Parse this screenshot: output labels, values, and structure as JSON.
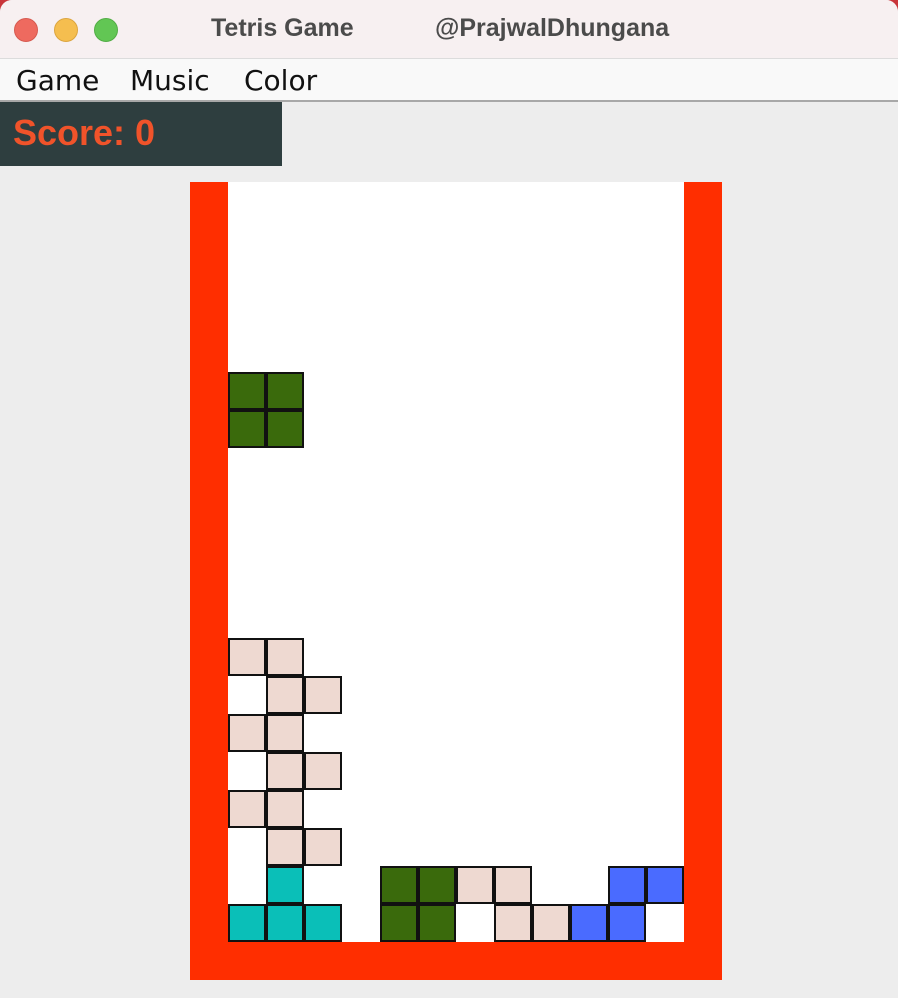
{
  "window": {
    "title": "Tetris Game",
    "author": "@PrajwalDhungana"
  },
  "menu": [
    "Game",
    "Music",
    "Color"
  ],
  "score": {
    "label": "Score: 0",
    "value": 0
  },
  "colors": {
    "frame": "#ff2e00",
    "board": "#ffffff",
    "score_panel": "#2e3e3f",
    "score_text": "#f0532a",
    "green": "#3a6a0c",
    "pink": "#eed9d1",
    "teal": "#0abfb8",
    "blue": "#4a6bff"
  },
  "board": {
    "columns": 12,
    "rows": 20,
    "active_piece": {
      "type": "O",
      "color": "green",
      "cells": [
        [
          0,
          5
        ],
        [
          1,
          5
        ],
        [
          0,
          6
        ],
        [
          1,
          6
        ]
      ]
    },
    "locked_cells": [
      {
        "col": 0,
        "row": 12,
        "color": "pink"
      },
      {
        "col": 1,
        "row": 12,
        "color": "pink"
      },
      {
        "col": 1,
        "row": 13,
        "color": "pink"
      },
      {
        "col": 2,
        "row": 13,
        "color": "pink"
      },
      {
        "col": 0,
        "row": 14,
        "color": "pink"
      },
      {
        "col": 1,
        "row": 14,
        "color": "pink"
      },
      {
        "col": 1,
        "row": 15,
        "color": "pink"
      },
      {
        "col": 2,
        "row": 15,
        "color": "pink"
      },
      {
        "col": 0,
        "row": 16,
        "color": "pink"
      },
      {
        "col": 1,
        "row": 16,
        "color": "pink"
      },
      {
        "col": 1,
        "row": 17,
        "color": "pink"
      },
      {
        "col": 2,
        "row": 17,
        "color": "pink"
      },
      {
        "col": 1,
        "row": 18,
        "color": "teal"
      },
      {
        "col": 4,
        "row": 18,
        "color": "green"
      },
      {
        "col": 5,
        "row": 18,
        "color": "green"
      },
      {
        "col": 6,
        "row": 18,
        "color": "pink"
      },
      {
        "col": 7,
        "row": 18,
        "color": "pink"
      },
      {
        "col": 10,
        "row": 18,
        "color": "blue"
      },
      {
        "col": 11,
        "row": 18,
        "color": "blue"
      },
      {
        "col": 0,
        "row": 19,
        "color": "teal"
      },
      {
        "col": 1,
        "row": 19,
        "color": "teal"
      },
      {
        "col": 2,
        "row": 19,
        "color": "teal"
      },
      {
        "col": 4,
        "row": 19,
        "color": "green"
      },
      {
        "col": 5,
        "row": 19,
        "color": "green"
      },
      {
        "col": 7,
        "row": 19,
        "color": "pink"
      },
      {
        "col": 8,
        "row": 19,
        "color": "pink"
      },
      {
        "col": 9,
        "row": 19,
        "color": "blue"
      },
      {
        "col": 10,
        "row": 19,
        "color": "blue"
      }
    ]
  }
}
